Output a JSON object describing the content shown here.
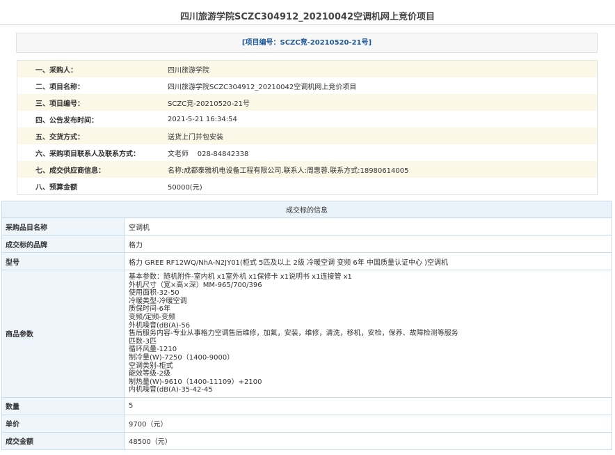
{
  "page_title": "四川旅游学院SCZC304912_20210042空调机网上竞价项目",
  "project_code_line": "[项目编号：SCZC竞-20210520-21号]",
  "info_rows": [
    {
      "label": "一、采购人：",
      "value": "四川旅游学院"
    },
    {
      "label": "二、项目名称：",
      "value": "四川旅游学院SCZC304912_20210042空调机网上竞价项目"
    },
    {
      "label": "三、项目编号：",
      "value": "SCZC竞-20210520-21号"
    },
    {
      "label": "四、公告发布时间：",
      "value": "2021-5-21 16:34:54"
    },
    {
      "label": "五、交货方式：",
      "value": "送货上门并包安装"
    },
    {
      "label": "六、采购项目联系人及联系方式：",
      "value": "文老师    028-84842338"
    },
    {
      "label": "七、成交供应商信息：",
      "value": "名称:成都泰雅机电设备工程有限公司.联系人:周惠蓉.联系方式:18980614005"
    },
    {
      "label": "八、预算金额",
      "value": "50000(元)"
    }
  ],
  "result": {
    "header": "成交标的信息",
    "item_name": {
      "label": "采购品目名称",
      "value": "空调机"
    },
    "brand": {
      "label": "成交标的品牌",
      "value": "格力"
    },
    "model": {
      "label": "型号",
      "value": "格力 GREE RF12WQ/NhA-N2JY01(柜式 5匹及以上 2级 冷暖空调 变频 6年 中国质量认证中心 )空调机"
    },
    "params": {
      "label": "商品参数",
      "lines": [
        "基本参数：随机附件-室内机 x1室外机 x1保修卡 x1说明书 x1连接管 x1",
        "外机尺寸（宽×高×深）MM-965/700/396",
        "使用面积-32-50",
        "冷暖类型-冷暖空调",
        "质保时间-6年",
        "变频/定频-变频",
        "外机噪音(dB(A)-56",
        "售后服务内容-专业从事格力空调售后维修，加氟，安装，维修，清洗，移机，安检，保养、故障检测等服务",
        "匹数-3匹",
        "循环风量-1210",
        "制冷量(W)-7250（1400-9000）",
        "空调类别-柜式",
        "能效等级-2级",
        "制热量(W)-9610（1400-11109）+2100",
        "内机噪音(dB(A)-35-42-45"
      ]
    },
    "quantity": {
      "label": "数量",
      "value": "5"
    },
    "unit_price": {
      "label": "单价",
      "value": "9700（元）"
    },
    "total": {
      "label": "成交金额",
      "value": "48500（元）"
    }
  }
}
